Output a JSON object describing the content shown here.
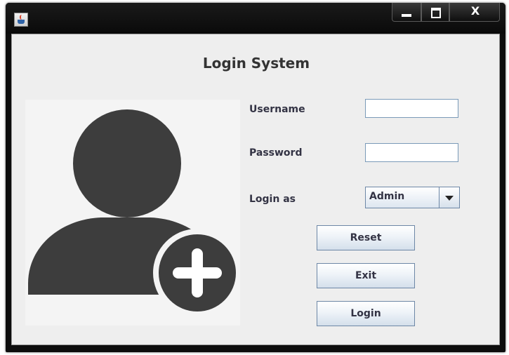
{
  "window": {
    "title": "",
    "icon": "java-icon",
    "controls": {
      "minimize": "minimize-icon",
      "maximize": "maximize-icon",
      "close_label": "X"
    }
  },
  "form": {
    "title": "Login System",
    "avatar_icon": "add-user-icon",
    "username_label": "Username",
    "username_value": "",
    "password_label": "Password",
    "password_value": "",
    "login_as_label": "Login as",
    "login_as_selected": "Admin",
    "buttons": {
      "reset": "Reset",
      "exit": "Exit",
      "login": "Login"
    }
  },
  "colors": {
    "background": "#eeeeee",
    "avatar": "#3d3d3d",
    "text": "#333344",
    "button_border": "#6d87a6"
  }
}
